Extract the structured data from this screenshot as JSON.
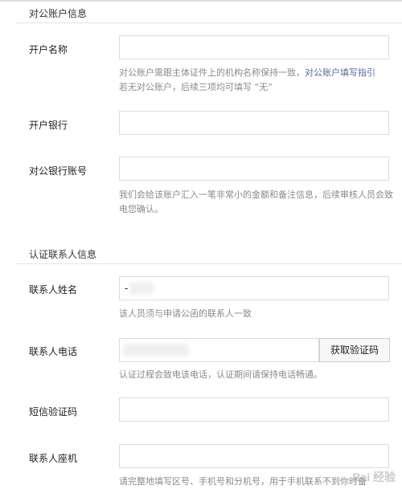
{
  "sections": {
    "account": {
      "title": "对公账户信息",
      "account_name": {
        "label": "开户名称",
        "value": "",
        "hint_prefix": "对公账户需跟主体证件上的机构名称保持一致，",
        "hint_link": "对公账户填写指引",
        "hint_suffix": "若无对公账户，后续三项均可填写 “无”"
      },
      "bank": {
        "label": "开户银行",
        "value": ""
      },
      "account_number": {
        "label": "对公银行账号",
        "value": "",
        "hint": "我们会给该账户汇入一笔非常小的金额和备注信息，后续审核人员会致电您确认。"
      }
    },
    "contact": {
      "title": "认证联系人信息",
      "name": {
        "label": "联系人姓名",
        "value": "-",
        "hint": "该人员须与申请公函的联系人一致"
      },
      "phone": {
        "label": "联系人电话",
        "value": "",
        "button": "获取验证码",
        "hint": "认证过程会致电该电话，认证期间请保持电话畅通。"
      },
      "sms_code": {
        "label": "短信验证码",
        "value": ""
      },
      "landline": {
        "label": "联系人座机",
        "value": "",
        "hint": "请完整地填写区号、手机号和分机号，用于手机联系不到你时备"
      }
    }
  },
  "watermark": "Bai 经验"
}
